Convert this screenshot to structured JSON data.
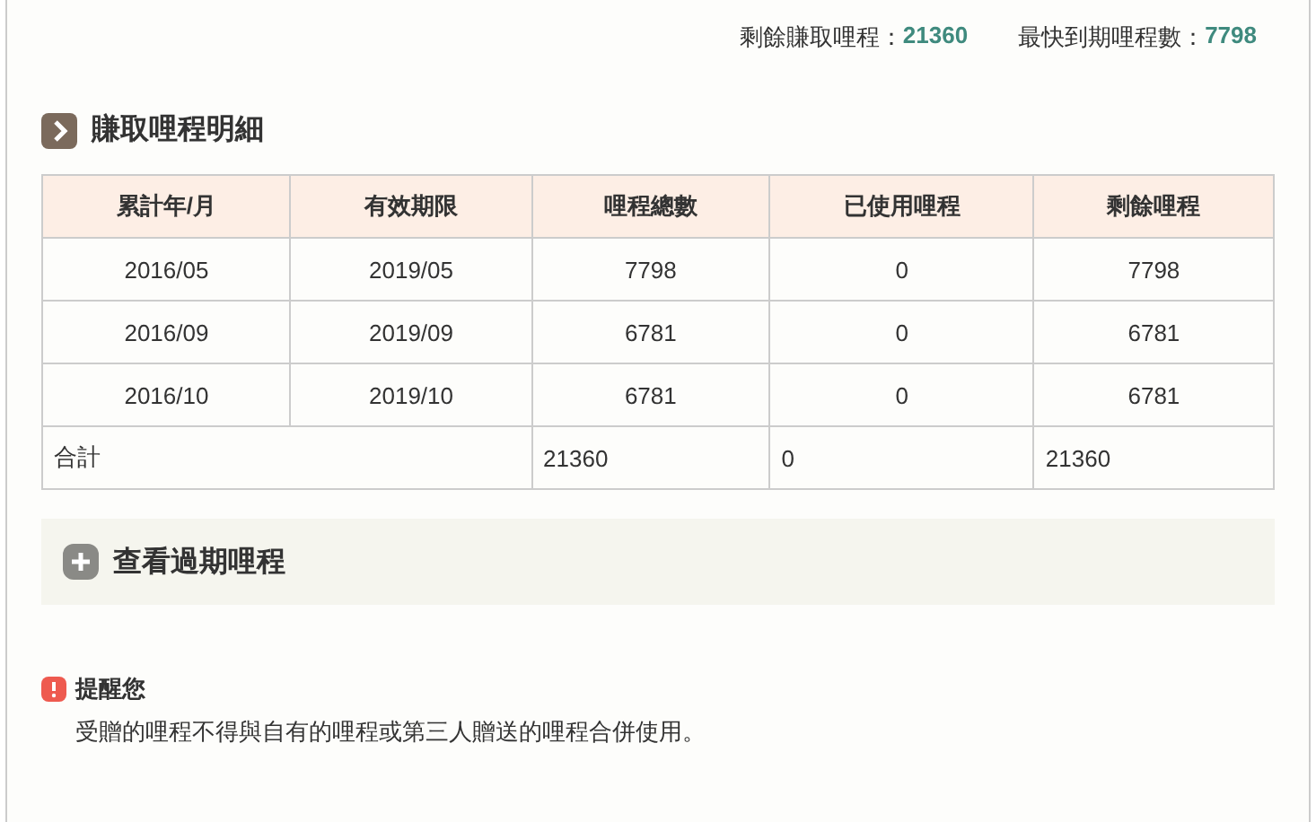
{
  "summary": [
    {
      "label": "剩餘賺取哩程：",
      "value": "21360"
    },
    {
      "label": "最快到期哩程數：",
      "value": "7798"
    }
  ],
  "section_title": "賺取哩程明細",
  "table": {
    "columns": [
      "累計年/月",
      "有效期限",
      "哩程總數",
      "已使用哩程",
      "剩餘哩程"
    ],
    "rows": [
      [
        "2016/05",
        "2019/05",
        "7798",
        "0",
        "7798"
      ],
      [
        "2016/09",
        "2019/09",
        "6781",
        "0",
        "6781"
      ],
      [
        "2016/10",
        "2019/10",
        "6781",
        "0",
        "6781"
      ]
    ],
    "total": {
      "label": "合計",
      "cells": [
        "21360",
        "0",
        "21360"
      ]
    }
  },
  "expired_toggle": {
    "label": "查看過期哩程",
    "expanded": false
  },
  "notice": {
    "title": "提醒您",
    "text": "受贈的哩程不得與自有的哩程或第三人贈送的哩程合併使用。"
  }
}
